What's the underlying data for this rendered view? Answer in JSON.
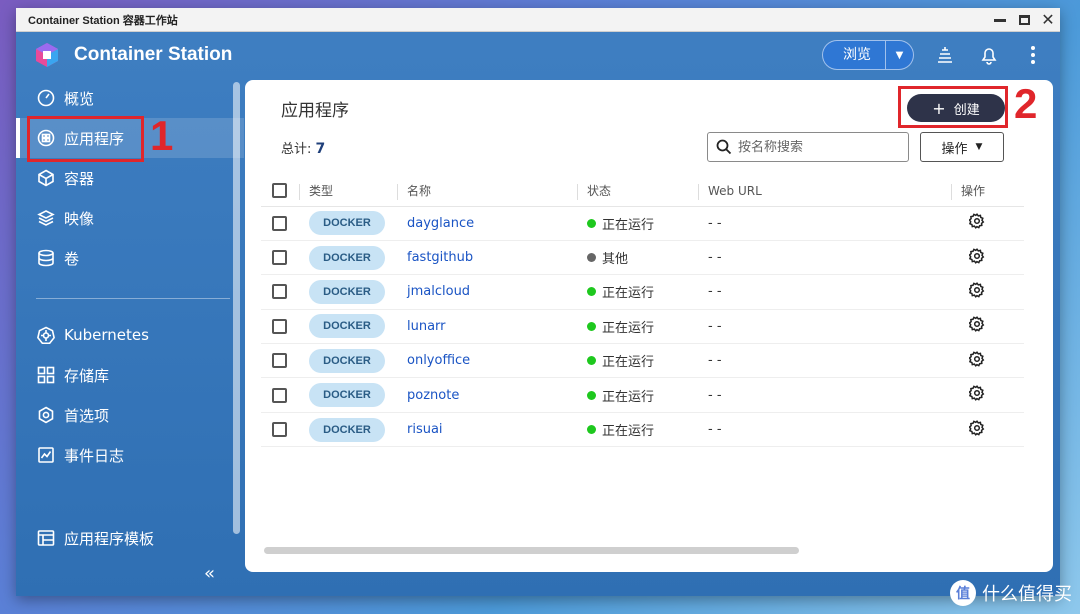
{
  "window": {
    "title": "Container Station 容器工作站"
  },
  "header": {
    "app_name": "Container Station",
    "browse_label": "浏览"
  },
  "sidebar": {
    "items": [
      {
        "label": "概览",
        "icon": "gauge-icon"
      },
      {
        "label": "应用程序",
        "icon": "apps-icon",
        "active": true
      },
      {
        "label": "容器",
        "icon": "cube-icon"
      },
      {
        "label": "映像",
        "icon": "layers-icon"
      },
      {
        "label": "卷",
        "icon": "database-icon"
      }
    ],
    "items2": [
      {
        "label": "Kubernetes",
        "icon": "kubernetes-icon"
      },
      {
        "label": "存储库",
        "icon": "grid-icon"
      },
      {
        "label": "首选项",
        "icon": "settings-icon"
      },
      {
        "label": "事件日志",
        "icon": "log-icon"
      }
    ],
    "template_label": "应用程序模板"
  },
  "annotations": {
    "n1": "1",
    "n2": "2"
  },
  "main": {
    "title": "应用程序",
    "create_label": "创建",
    "total_label": "总计:",
    "total_value": "7",
    "search_placeholder": "按名称搜索",
    "ops_label": "操作",
    "columns": [
      "类型",
      "名称",
      "状态",
      "Web URL",
      "操作"
    ],
    "rows": [
      {
        "type": "DOCKER",
        "name": "dayglance",
        "status": "正在运行",
        "status_color": "#1ec81e",
        "url": "- -"
      },
      {
        "type": "DOCKER",
        "name": "fastgithub",
        "status": "其他",
        "status_color": "#666666",
        "url": "- -"
      },
      {
        "type": "DOCKER",
        "name": "jmalcloud",
        "status": "正在运行",
        "status_color": "#1ec81e",
        "url": "- -"
      },
      {
        "type": "DOCKER",
        "name": "lunarr",
        "status": "正在运行",
        "status_color": "#1ec81e",
        "url": "- -"
      },
      {
        "type": "DOCKER",
        "name": "onlyoffice",
        "status": "正在运行",
        "status_color": "#1ec81e",
        "url": "- -"
      },
      {
        "type": "DOCKER",
        "name": "poznote",
        "status": "正在运行",
        "status_color": "#1ec81e",
        "url": "- -"
      },
      {
        "type": "DOCKER",
        "name": "risuai",
        "status": "正在运行",
        "status_color": "#1ec81e",
        "url": "- -"
      }
    ]
  },
  "watermark": {
    "text": "什么值得买",
    "badge": "值"
  }
}
